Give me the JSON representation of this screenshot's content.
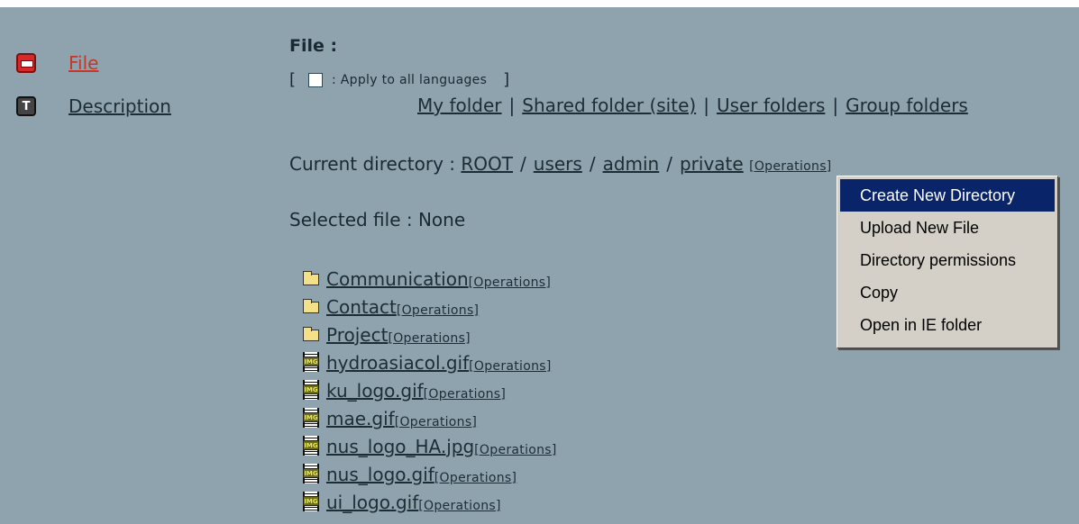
{
  "nav": [
    {
      "label": "File",
      "icon": "file-tab-icon",
      "active": true
    },
    {
      "label": "Description",
      "icon": "text-t-icon",
      "active": false
    }
  ],
  "main": {
    "title": "File :",
    "lang_open": "[",
    "lang_label": ": Apply to all languages",
    "lang_close": "]",
    "folders": [
      "My folder",
      "Shared folder (site)",
      "User folders",
      "Group folders"
    ],
    "folder_sep": "|",
    "curdir_label": "Current directory :",
    "path": [
      "ROOT",
      "users",
      "admin",
      "private"
    ],
    "path_sep": "/",
    "ops_label": "[Operations]",
    "selected_file": "Selected file : None"
  },
  "files": [
    {
      "name": "Communication",
      "type": "folder"
    },
    {
      "name": "Contact",
      "type": "folder"
    },
    {
      "name": "Project",
      "type": "folder"
    },
    {
      "name": "hydroasiacol.gif",
      "type": "image"
    },
    {
      "name": "ku_logo.gif",
      "type": "image"
    },
    {
      "name": "mae.gif",
      "type": "image"
    },
    {
      "name": "nus_logo_HA.jpg",
      "type": "image"
    },
    {
      "name": "nus_logo.gif",
      "type": "image"
    },
    {
      "name": "ui_logo.gif",
      "type": "image"
    }
  ],
  "img_icon_text": "IMG",
  "context_menu": {
    "items": [
      "Create New Directory",
      "Upload New File",
      "Directory permissions",
      "Copy",
      "Open in IE folder"
    ],
    "highlighted": "Create New Directory"
  }
}
